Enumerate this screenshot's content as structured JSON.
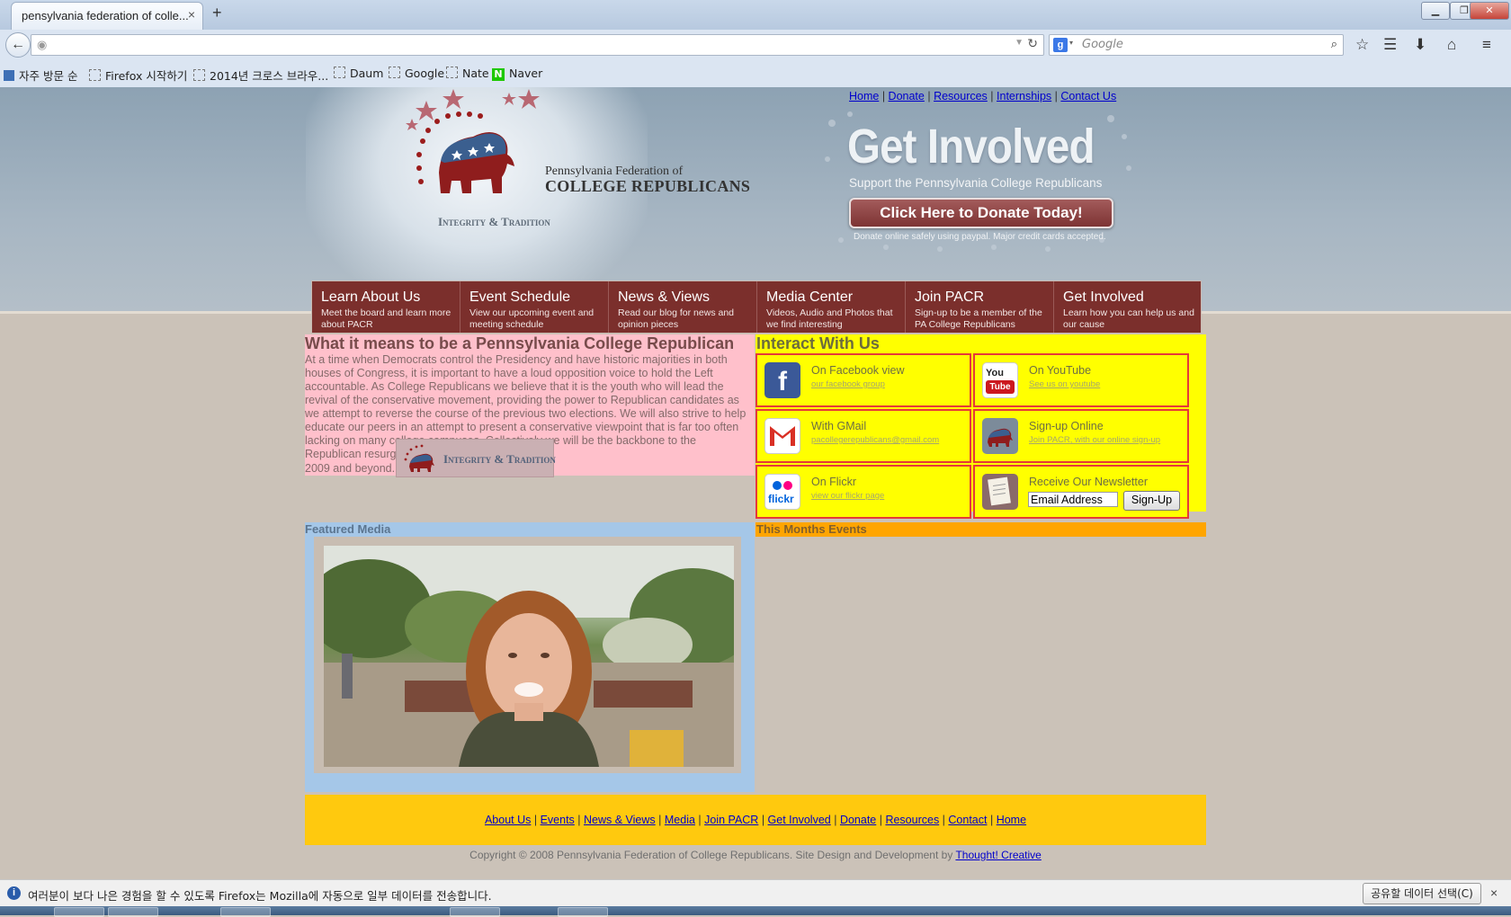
{
  "browser": {
    "tab_title": "pensylvania federation of colle...",
    "tab_close": "×",
    "new_tab": "+",
    "url_value": "",
    "search_placeholder": "Google",
    "search_engine_icon": "g-icon",
    "window_buttons": [
      "minimize",
      "restore",
      "close"
    ]
  },
  "bookmarks": [
    {
      "label": "자주 방문 순",
      "icon": "bookmark-icon"
    },
    {
      "label": "Firefox 시작하기",
      "icon": "page-icon"
    },
    {
      "label": "2014년 크로스 브라우...",
      "icon": "page-icon"
    },
    {
      "label": "Daum",
      "icon": "page-icon"
    },
    {
      "label": "Google",
      "icon": "page-icon"
    },
    {
      "label": "Nate",
      "icon": "page-icon"
    },
    {
      "label": "Naver",
      "icon": "naver-icon"
    }
  ],
  "header": {
    "top_links": [
      "Home",
      "Donate",
      "Resources",
      "Internships",
      "Contact Us"
    ],
    "logo_line1": "Pennsylvania Federation of",
    "logo_line2": "COLLEGE REPUBLICANS",
    "logo_tagline": "Integrity & Tradition",
    "get_involved_title": "Get Involved",
    "get_involved_sub": "Support the Pennsylvania College Republicans",
    "donate_button": "Click Here to Donate Today!",
    "donate_note": "Donate online safely using paypal. Major credit cards accepted."
  },
  "nav": [
    {
      "title": "Learn About Us",
      "desc": "Meet the board and learn more about PACR"
    },
    {
      "title": "Event Schedule",
      "desc": "View our upcoming event and meeting schedule"
    },
    {
      "title": "News & Views",
      "desc": "Read our blog for news and opinion pieces"
    },
    {
      "title": "Media Center",
      "desc": "Videos, Audio and Photos that we find interesting"
    },
    {
      "title": "Join PACR",
      "desc": "Sign-up to be a member of the PA College Republicans"
    },
    {
      "title": "Get Involved",
      "desc": "Learn how you can help us and our cause"
    }
  ],
  "about": {
    "title": "What it means to be a Pennsylvania College Republican",
    "body": "At a time when Democrats control the Presidency and have historic majorities in both houses of Congress, it is important to have a loud opposition voice to hold the Left accountable. As College Republicans we believe that it is the youth who will lead the revival of the conservative movement, providing the power to Republican candidates as we attempt to reverse the course of the previous two elections. We will also strive to help educate our peers in an attempt to present a conservative viewpoint that is far too often lacking on many college campuses. Collectively we will be the backbone to the Republican resurgence in",
    "body_end": "2009 and beyond.",
    "badge_text": "Integrity & Tradition"
  },
  "interact": {
    "title": "Interact With Us",
    "cells": [
      {
        "title": "On Facebook view",
        "link": "our facebook group",
        "icon": "facebook-icon"
      },
      {
        "title": "On YouTube",
        "link": "See us on youtube",
        "icon": "youtube-icon"
      },
      {
        "title": "With GMail",
        "link": "pacollegerepublicans@gmail.com",
        "icon": "gmail-icon"
      },
      {
        "title": "Sign-up Online",
        "link": "Join PACR, with our online sign-up",
        "icon": "elephant-icon"
      },
      {
        "title": "On Flickr",
        "link": "view our flickr page",
        "icon": "flickr-icon"
      },
      {
        "title": "Receive Our Newsletter",
        "icon": "newsletter-icon"
      }
    ],
    "newsletter_input": "Email Address",
    "newsletter_button": "Sign-Up"
  },
  "featured": {
    "title": "Featured Media"
  },
  "events": {
    "title": "This Months Events"
  },
  "footer": {
    "links": [
      "About Us",
      "Events",
      "News & Views",
      "Media",
      "Join PACR",
      "Get Involved",
      "Donate",
      "Resources",
      "Contact",
      "Home"
    ],
    "copyright": "Copyright © 2008 Pennsylvania Federation of College Republicans. Site Design and Development by",
    "credit_link": "Thought! Creative"
  },
  "notification": {
    "text": "여러분이 보다 나은 경험을 할 수 있도록 Firefox는 Mozilla에 자동으로 일부 데이터를 전송합니다.",
    "button": "공유할 데이터 선택(C)",
    "close": "×"
  },
  "colors": {
    "nav_bg": "#7b2f2c",
    "about_bg": "#ffc0cb",
    "interact_bg": "#ffff00",
    "featured_bg": "#a5c7e8",
    "events_bg": "#ffa500",
    "footer_bg": "#ffc90e",
    "page_bg": "#cbc2b8"
  }
}
